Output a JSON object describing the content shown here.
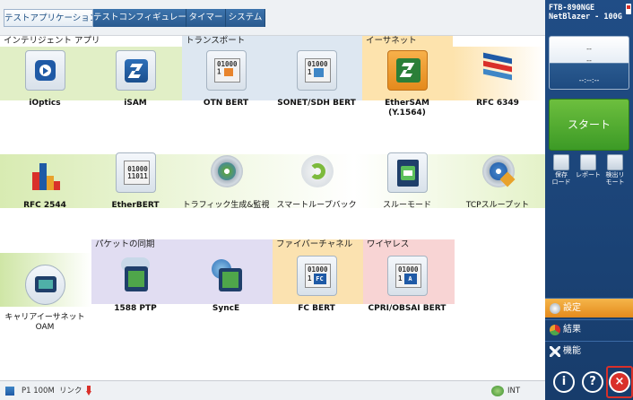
{
  "tabs": [
    {
      "label": "テストアプリケーション",
      "active": true
    },
    {
      "label": "テストコンフィギュレータ",
      "active": false
    },
    {
      "label": "タイマー",
      "active": false
    },
    {
      "label": "システム",
      "active": false
    }
  ],
  "groups": {
    "intelligent": "インテリジェント アプリ",
    "transport": "トランスポート",
    "ethernet": "イーサネット",
    "sync": "パケットの同期",
    "fibre": "ファイバーチャネル",
    "wireless": "ワイヤレス"
  },
  "apps": {
    "ioptics": {
      "label": "iOptics",
      "icon": "ioptics-icon"
    },
    "isam": {
      "label": "iSAM",
      "icon": "isam-icon"
    },
    "otn_bert": {
      "label": "OTN BERT",
      "icon": "otn-bert-icon",
      "digits": "01000 1"
    },
    "sonet_bert": {
      "label": "SONET/SDH BERT",
      "icon": "sonet-bert-icon",
      "digits": "01000 1"
    },
    "ethersam": {
      "label": "EtherSAM\n(Y.1564)",
      "icon": "ethersam-icon"
    },
    "rfc6349": {
      "label": "RFC 6349",
      "icon": "rfc6349-icon"
    },
    "rfc2544": {
      "label": "RFC 2544",
      "icon": "rfc2544-icon"
    },
    "etherbert": {
      "label": "EtherBERT",
      "icon": "etherbert-icon",
      "digits": "01000\n11011"
    },
    "traffic_gen": {
      "label": "トラフィック生成&監視",
      "icon": "traffic-gen-icon"
    },
    "smart_loopback": {
      "label": "スマートループバック",
      "icon": "smart-loopback-icon"
    },
    "through_mode": {
      "label": "スルーモード",
      "icon": "through-mode-icon"
    },
    "tcp_throughput": {
      "label": "TCPスループット",
      "icon": "tcp-throughput-icon"
    },
    "carrier_oam": {
      "label": "キャリアイーサネット\nOAM",
      "icon": "carrier-oam-icon"
    },
    "ptp1588": {
      "label": "1588 PTP",
      "icon": "ptp-icon"
    },
    "synce": {
      "label": "SyncE",
      "icon": "synce-icon"
    },
    "fc_bert": {
      "label": "FC BERT",
      "icon": "fc-bert-icon",
      "digits": "01000 1",
      "badge": "FC"
    },
    "cpri_bert": {
      "label": "CPRI/OBSAI BERT",
      "icon": "cpri-bert-icon",
      "digits": "01000 1",
      "badge": "A"
    }
  },
  "status": {
    "port": "P1 100M",
    "link": "リンク",
    "clock": "INT"
  },
  "right_panel": {
    "model": "FTB-890NGE",
    "model_sub": "NetBlazer - 100G",
    "readout_top": "--",
    "readout_mid": "--",
    "readout_time": "--:--:--",
    "start": "スタート",
    "save_load": "保存\nロード",
    "report": "レポート",
    "discover": "検出リ\nモート",
    "menu_setup": "設定",
    "menu_results": "結果",
    "menu_functions": "機能"
  },
  "colors": {
    "accent_blue": "#204d86",
    "green_band": "#d8ebb2",
    "transport_band": "#dde7f1",
    "ethernet_band": "#fde3ad",
    "sync_band": "#e1ddf2",
    "fibre_band": "#fbe2b0",
    "wireless_band": "#f8d4d4",
    "start_green": "#4aa82c",
    "exit_red": "#d9302a"
  }
}
